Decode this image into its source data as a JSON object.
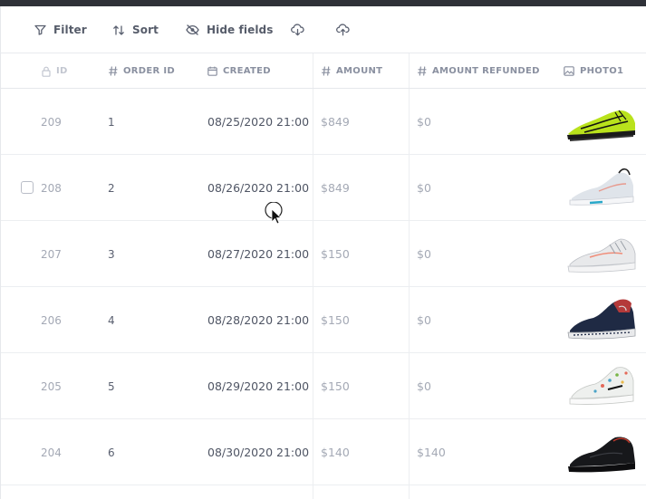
{
  "toolbar": {
    "filter_label": "Filter",
    "sort_label": "Sort",
    "hide_fields_label": "Hide fields"
  },
  "columns": {
    "id": "ID",
    "order_id": "ORDER ID",
    "created": "CREATED",
    "amount": "AMOUNT",
    "amount_refunded": "AMOUNT REFUNDED",
    "photo1": "PHOTO1"
  },
  "rows": [
    {
      "id": "209",
      "order_id": "1",
      "created": "08/25/2020 21:00",
      "amount": "$849",
      "amount_refunded": "$0",
      "photo": "green-black-running-shoe"
    },
    {
      "id": "208",
      "order_id": "2",
      "created": "08/26/2020 21:00",
      "amount": "$849",
      "amount_refunded": "$0",
      "photo": "white-grey-training-shoe"
    },
    {
      "id": "207",
      "order_id": "3",
      "created": "08/27/2020 21:00",
      "amount": "$150",
      "amount_refunded": "$0",
      "photo": "white-lifestyle-sneaker"
    },
    {
      "id": "206",
      "order_id": "4",
      "created": "08/28/2020 21:00",
      "amount": "$150",
      "amount_refunded": "$0",
      "photo": "navy-red-basketball-shoe"
    },
    {
      "id": "205",
      "order_id": "5",
      "created": "08/29/2020 21:00",
      "amount": "$150",
      "amount_refunded": "$0",
      "photo": "white-multicolor-basketball-shoe"
    },
    {
      "id": "204",
      "order_id": "6",
      "created": "08/30/2020 21:00",
      "amount": "$140",
      "amount_refunded": "$140",
      "photo": "black-basketball-shoe"
    }
  ],
  "colors": {
    "topbar": "#2f3138",
    "header_text": "#8a90a0",
    "muted_text": "#a4a9b5",
    "grid_line": "#eceef1"
  }
}
